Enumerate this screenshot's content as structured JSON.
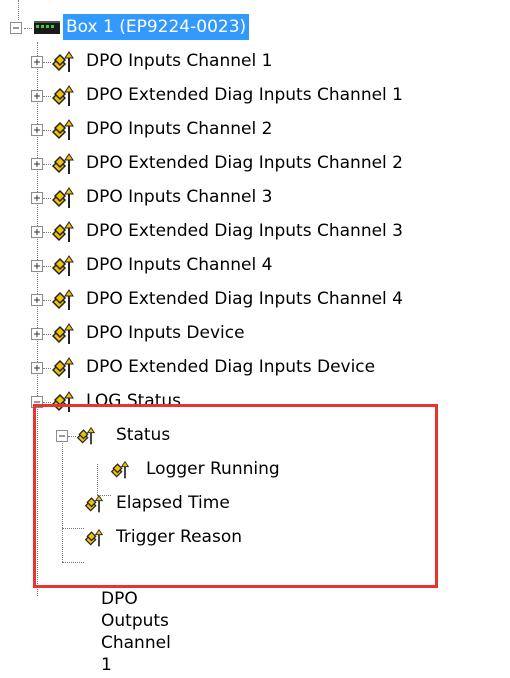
{
  "tree": {
    "root": {
      "label": "Box 1 (EP9224-0023)",
      "icon": "box-module-icon",
      "expanded": true
    },
    "items": [
      {
        "label": "DPO Inputs Channel 1",
        "icon": "input-variable-icon",
        "expanded": false
      },
      {
        "label": "DPO Extended Diag Inputs Channel 1",
        "icon": "input-variable-icon",
        "expanded": false
      },
      {
        "label": "DPO Inputs Channel 2",
        "icon": "input-variable-icon",
        "expanded": false
      },
      {
        "label": "DPO Extended Diag Inputs Channel 2",
        "icon": "input-variable-icon",
        "expanded": false
      },
      {
        "label": "DPO Inputs Channel 3",
        "icon": "input-variable-icon",
        "expanded": false
      },
      {
        "label": "DPO Extended Diag Inputs Channel 3",
        "icon": "input-variable-icon",
        "expanded": false
      },
      {
        "label": "DPO Inputs Channel 4",
        "icon": "input-variable-icon",
        "expanded": false
      },
      {
        "label": "DPO Extended Diag Inputs Channel 4",
        "icon": "input-variable-icon",
        "expanded": false
      },
      {
        "label": "DPO Inputs Device",
        "icon": "input-variable-icon",
        "expanded": false
      },
      {
        "label": "DPO Extended Diag Inputs Device",
        "icon": "input-variable-icon",
        "expanded": false
      },
      {
        "label": "LOG Status",
        "icon": "input-variable-icon",
        "expanded": true
      },
      {
        "label": "Status",
        "icon": "input-variable-small-icon",
        "expanded": true
      },
      {
        "label": "Logger Running",
        "icon": "input-variable-small-icon"
      },
      {
        "label": "Elapsed Time",
        "icon": "input-variable-small-icon"
      },
      {
        "label": "Trigger Reason",
        "icon": "input-variable-small-icon"
      }
    ],
    "cutoff_item": {
      "label": "DPO Outputs Channel 1"
    }
  },
  "colors": {
    "selection": "#3399ff",
    "highlight_border": "#e8342e",
    "icon_yellow": "#f2c200",
    "icon_dark": "#222222",
    "tree_lines": "#7a7a7a"
  }
}
